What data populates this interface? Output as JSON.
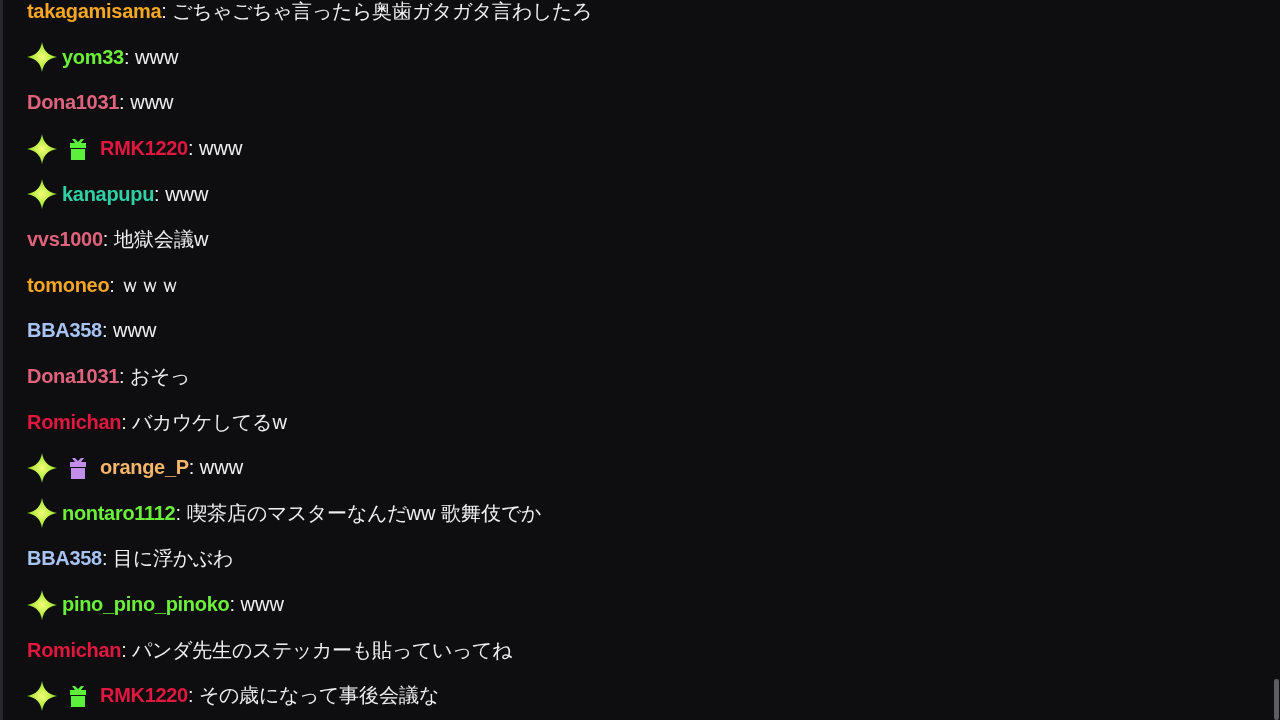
{
  "chat": {
    "messages": [
      {
        "user": "takagamisama",
        "color": "#f5a623",
        "text": ": ごちゃごちゃ言ったら奥歯ガタガタ言わしたろ"
      },
      {
        "user": "yom33",
        "color": "#6bf03a",
        "badges": [
          {
            "kind": "sparkle"
          }
        ],
        "text": ": www"
      },
      {
        "user": "Dona1031",
        "color": "#e0637e",
        "text": ": www"
      },
      {
        "user": "RMK1220",
        "color": "#e0173f",
        "badges": [
          {
            "kind": "sparkle"
          },
          {
            "kind": "gift",
            "color": "#5cf03c"
          }
        ],
        "text": ": www"
      },
      {
        "user": "kanapupu",
        "color": "#2ed1a6",
        "badges": [
          {
            "kind": "sparkle"
          }
        ],
        "text": ": www"
      },
      {
        "user": "vvs1000",
        "color": "#e0637e",
        "text": ": 地獄会議w"
      },
      {
        "user": "tomoneo",
        "color": "#f5a623",
        "text": ": ｗｗｗ"
      },
      {
        "user": "BBA358",
        "color": "#a7c3f2",
        "text": ": www"
      },
      {
        "user": "Dona1031",
        "color": "#e0637e",
        "text": ": おそっ"
      },
      {
        "user": "Romichan",
        "color": "#e0173f",
        "text": ": バカウケしてるw"
      },
      {
        "user": "orange_P",
        "color": "#f5b66a",
        "badges": [
          {
            "kind": "sparkle"
          },
          {
            "kind": "gift",
            "color": "#c28ee8"
          }
        ],
        "text": ": www"
      },
      {
        "user": "nontaro1112",
        "color": "#6bf03a",
        "badges": [
          {
            "kind": "sparkle"
          }
        ],
        "text": ": 喫茶店のマスターなんだww 歌舞伎でか"
      },
      {
        "user": "BBA358",
        "color": "#a7c3f2",
        "text": ": 目に浮かぶわ"
      },
      {
        "user": "pino_pino_pinoko",
        "color": "#6bf03a",
        "badges": [
          {
            "kind": "sparkle"
          }
        ],
        "text": ": www"
      },
      {
        "user": "Romichan",
        "color": "#e0173f",
        "text": ": パンダ先生のステッカーも貼っていってね"
      },
      {
        "user": "RMK1220",
        "color": "#e0173f",
        "badges": [
          {
            "kind": "sparkle"
          },
          {
            "kind": "gift",
            "color": "#5cf03c"
          }
        ],
        "text": ": その歳になって事後会議な"
      }
    ]
  }
}
